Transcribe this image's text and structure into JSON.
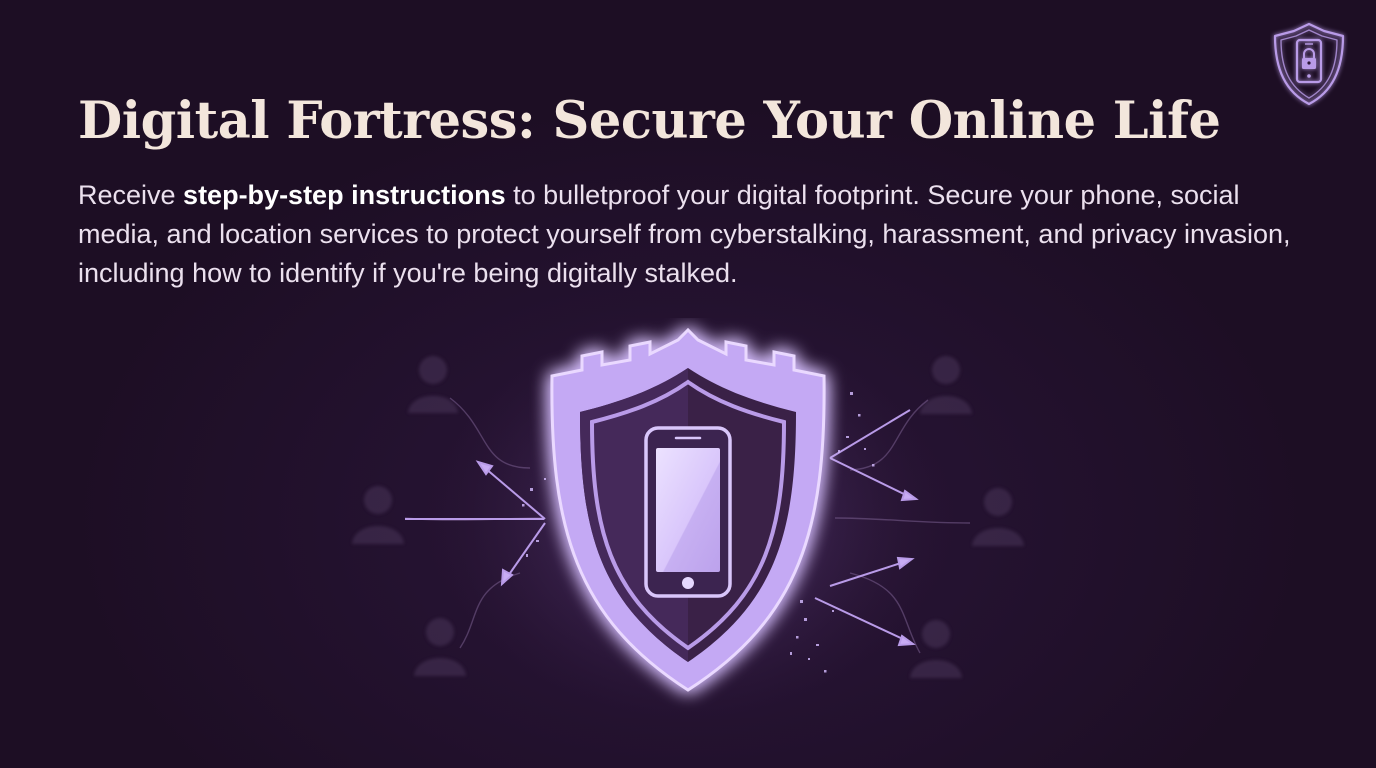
{
  "title": "Digital Fortress: Secure Your Online Life",
  "description": {
    "prefix": "Receive ",
    "emphasis": "step-by-step instructions",
    "suffix": " to bulletproof your digital footprint. Secure your phone, social media, and location services to protect yourself from cyberstalking, harassment, and privacy invasion, including how to identify if you're being digitally stalked."
  },
  "icons": {
    "badge": "shield-phone-lock-icon",
    "hero": "castle-shield-phone-icon",
    "figures": "person-silhouette-icon",
    "attacks": "arrow-icon"
  },
  "colors": {
    "background": "#1f0f26",
    "title": "#f3e6dc",
    "text": "#ebe0ee",
    "accent": "#b99be8",
    "glow": "#c8a8ff"
  }
}
